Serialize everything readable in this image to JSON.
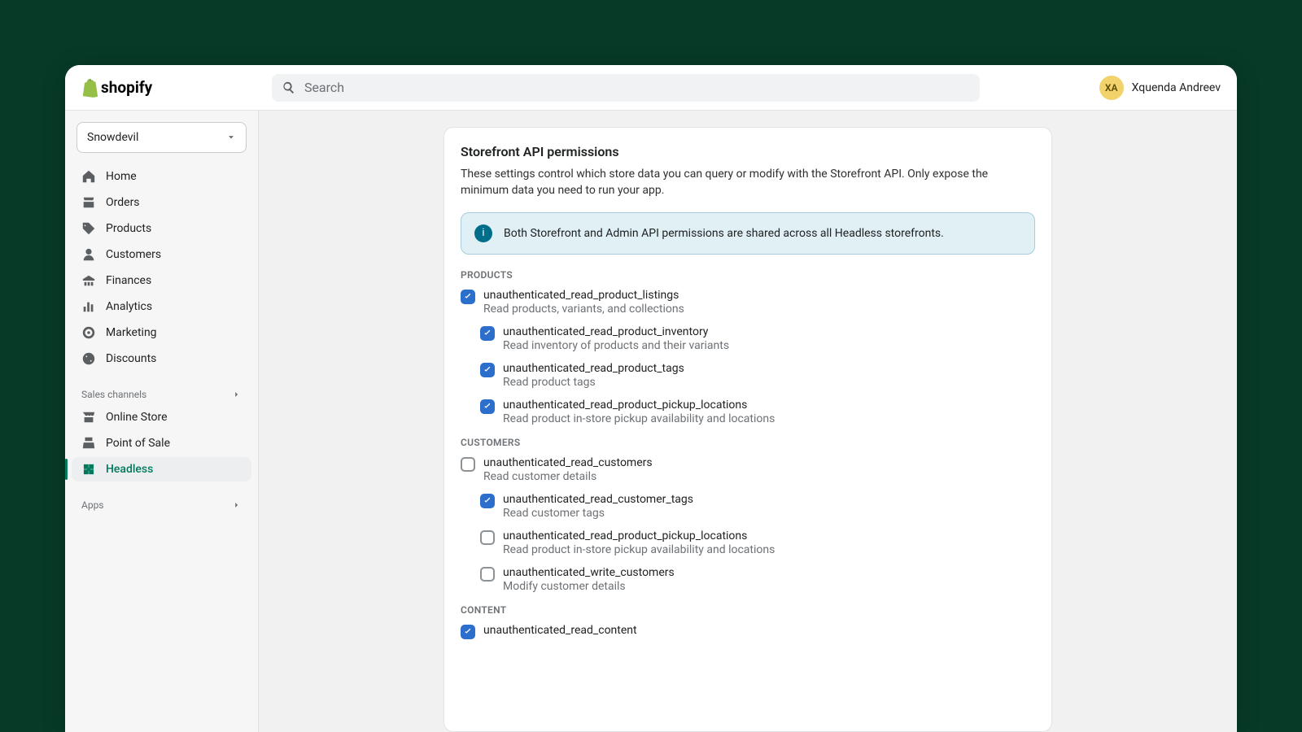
{
  "brand": "shopify",
  "search": {
    "placeholder": "Search"
  },
  "user": {
    "initials": "XA",
    "name": "Xquenda Andreev"
  },
  "store_selector": {
    "name": "Snowdevil"
  },
  "nav": {
    "items": [
      {
        "label": "Home",
        "icon": "home-icon"
      },
      {
        "label": "Orders",
        "icon": "orders-icon"
      },
      {
        "label": "Products",
        "icon": "products-icon"
      },
      {
        "label": "Customers",
        "icon": "customers-icon"
      },
      {
        "label": "Finances",
        "icon": "finances-icon"
      },
      {
        "label": "Analytics",
        "icon": "analytics-icon"
      },
      {
        "label": "Marketing",
        "icon": "marketing-icon"
      },
      {
        "label": "Discounts",
        "icon": "discounts-icon"
      }
    ],
    "sales_channels_label": "Sales channels",
    "channels": [
      {
        "label": "Online Store",
        "icon": "store-icon"
      },
      {
        "label": "Point of Sale",
        "icon": "pos-icon"
      },
      {
        "label": "Headless",
        "icon": "headless-icon",
        "active": true
      }
    ],
    "apps_label": "Apps"
  },
  "panel": {
    "title": "Storefront API permissions",
    "description": "These settings control which store data you can query or modify with the Storefront API. Only expose the minimum data you need to run your app.",
    "banner": "Both Storefront and Admin API permissions are shared across all Headless storefronts.",
    "groups": [
      {
        "label": "PRODUCTS",
        "perms": [
          {
            "name": "unauthenticated_read_product_listings",
            "desc": "Read products, variants, and collections",
            "checked": true,
            "sub": false
          },
          {
            "name": "unauthenticated_read_product_inventory",
            "desc": "Read inventory of products and their variants",
            "checked": true,
            "sub": true
          },
          {
            "name": "unauthenticated_read_product_tags",
            "desc": "Read product tags",
            "checked": true,
            "sub": true
          },
          {
            "name": "unauthenticated_read_product_pickup_locations",
            "desc": "Read product in-store pickup availability and locations",
            "checked": true,
            "sub": true
          }
        ]
      },
      {
        "label": "CUSTOMERS",
        "perms": [
          {
            "name": "unauthenticated_read_customers",
            "desc": "Read customer details",
            "checked": false,
            "sub": false
          },
          {
            "name": "unauthenticated_read_customer_tags",
            "desc": "Read customer tags",
            "checked": true,
            "sub": true
          },
          {
            "name": "unauthenticated_read_product_pickup_locations",
            "desc": "Read product in-store pickup availability and locations",
            "checked": false,
            "sub": true
          },
          {
            "name": "unauthenticated_write_customers",
            "desc": "Modify customer details",
            "checked": false,
            "sub": true
          }
        ]
      },
      {
        "label": "CONTENT",
        "perms": [
          {
            "name": "unauthenticated_read_content",
            "desc": "",
            "checked": true,
            "sub": false
          }
        ]
      }
    ]
  }
}
